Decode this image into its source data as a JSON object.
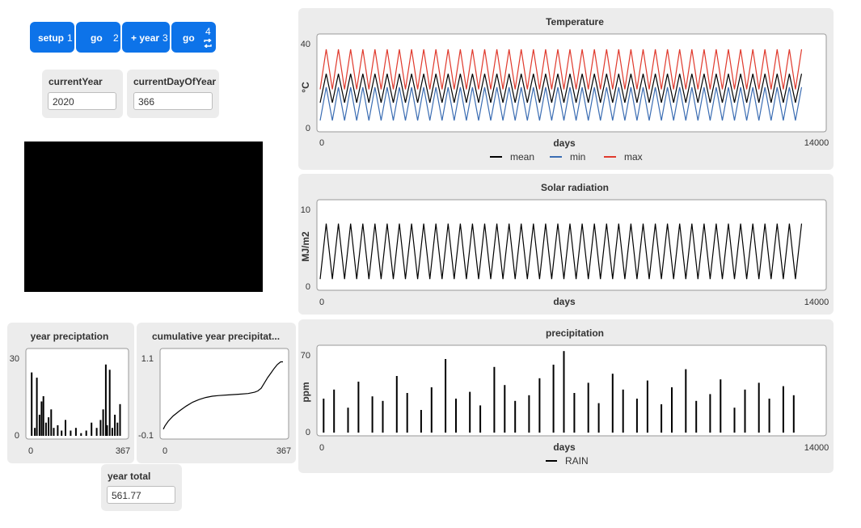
{
  "buttons": [
    {
      "label": "setup",
      "key": "1"
    },
    {
      "label": "go",
      "key": "2"
    },
    {
      "label": "+ year",
      "key": "3"
    },
    {
      "label": "go",
      "key": "4"
    }
  ],
  "monitors": {
    "current_year": {
      "label": "currentYear",
      "value": "2020"
    },
    "current_day": {
      "label": "currentDayOfYear",
      "value": "366"
    },
    "year_total": {
      "label": "year total",
      "value": "561.77"
    }
  },
  "colors": {
    "mean": "#000000",
    "min": "#3b6db3",
    "max": "#e03a2d",
    "rain": "#000000",
    "button": "#0d73e9"
  },
  "chart_data": [
    {
      "id": "temperature",
      "type": "line",
      "title": "Temperature",
      "xlabel": "days",
      "ylabel": "°C",
      "x_ticks": [
        "0",
        "14000"
      ],
      "y_ticks": [
        "40",
        "0"
      ],
      "xlim": [
        0,
        14000
      ],
      "ylim": [
        0,
        40
      ],
      "x": [
        0,
        175,
        350,
        525,
        700,
        875,
        1050,
        1225,
        1400,
        1575,
        1750,
        1925,
        2100,
        2275,
        2450,
        2625,
        2800,
        2975,
        3150,
        3325,
        3500,
        3675,
        3850,
        4025,
        4200,
        4375,
        4550,
        4725,
        4900,
        5075,
        5250,
        5425,
        5600,
        5775,
        5950,
        6125,
        6300,
        6475,
        6650,
        6825,
        7000,
        7175,
        7350,
        7525,
        7700,
        7875,
        8050,
        8225,
        8400,
        8575,
        8750,
        8925,
        9100,
        9275,
        9450,
        9625,
        9800,
        9975,
        10150,
        10325,
        10500,
        10675,
        10850,
        11025,
        11200,
        11375,
        11550,
        11725,
        11900,
        12075,
        12250,
        12425,
        12600,
        12775,
        12950,
        13125,
        13300,
        13475,
        13650,
        13825
      ],
      "series": [
        {
          "name": "mean",
          "values": [
            12,
            25,
            12,
            25,
            12,
            25,
            12,
            25,
            12,
            25,
            12,
            25,
            12,
            25,
            12,
            25,
            12,
            25,
            12,
            25,
            12,
            25,
            12,
            25,
            12,
            25,
            12,
            25,
            12,
            25,
            12,
            25,
            12,
            25,
            12,
            25,
            12,
            25,
            12,
            25,
            12,
            25,
            12,
            25,
            12,
            25,
            12,
            25,
            12,
            25,
            12,
            25,
            12,
            25,
            12,
            25,
            12,
            25,
            12,
            25,
            12,
            25,
            12,
            25,
            12,
            25,
            12,
            25,
            12,
            25,
            12,
            25,
            12,
            25,
            12,
            25,
            12,
            25,
            12,
            25
          ]
        },
        {
          "name": "min",
          "values": [
            4,
            19,
            4,
            19,
            4,
            19,
            4,
            19,
            4,
            19,
            4,
            19,
            4,
            19,
            4,
            19,
            4,
            19,
            4,
            19,
            4,
            19,
            4,
            19,
            4,
            19,
            4,
            19,
            4,
            19,
            4,
            19,
            4,
            19,
            4,
            19,
            4,
            19,
            4,
            19,
            4,
            19,
            4,
            19,
            4,
            19,
            4,
            19,
            4,
            19,
            4,
            19,
            4,
            19,
            4,
            19,
            4,
            19,
            4,
            19,
            4,
            19,
            4,
            19,
            4,
            19,
            4,
            19,
            4,
            19,
            4,
            19,
            4,
            19,
            4,
            19,
            4,
            19,
            4,
            19
          ]
        },
        {
          "name": "max",
          "values": [
            18,
            36,
            18,
            36,
            18,
            36,
            18,
            36,
            18,
            36,
            18,
            36,
            18,
            36,
            18,
            36,
            18,
            36,
            18,
            36,
            18,
            36,
            18,
            36,
            18,
            36,
            18,
            36,
            18,
            36,
            18,
            36,
            18,
            36,
            18,
            36,
            18,
            36,
            18,
            36,
            18,
            36,
            18,
            36,
            18,
            36,
            18,
            36,
            18,
            36,
            18,
            36,
            18,
            36,
            18,
            36,
            18,
            36,
            18,
            36,
            18,
            36,
            18,
            36,
            18,
            36,
            18,
            36,
            18,
            36,
            18,
            36,
            18,
            36,
            18,
            36,
            18,
            36,
            18,
            36
          ]
        }
      ],
      "legend": [
        "mean",
        "min",
        "max"
      ]
    },
    {
      "id": "solar",
      "type": "line",
      "title": "Solar radiation",
      "xlabel": "days",
      "ylabel": "MJ/m2",
      "x_ticks": [
        "0",
        "14000"
      ],
      "y_ticks": [
        "10",
        "0"
      ],
      "xlim": [
        0,
        14000
      ],
      "ylim": [
        0,
        10
      ],
      "x": [
        0,
        175,
        350,
        525,
        700,
        875,
        1050,
        1225,
        1400,
        1575,
        1750,
        1925,
        2100,
        2275,
        2450,
        2625,
        2800,
        2975,
        3150,
        3325,
        3500,
        3675,
        3850,
        4025,
        4200,
        4375,
        4550,
        4725,
        4900,
        5075,
        5250,
        5425,
        5600,
        5775,
        5950,
        6125,
        6300,
        6475,
        6650,
        6825,
        7000,
        7175,
        7350,
        7525,
        7700,
        7875,
        8050,
        8225,
        8400,
        8575,
        8750,
        8925,
        9100,
        9275,
        9450,
        9625,
        9800,
        9975,
        10150,
        10325,
        10500,
        10675,
        10850,
        11025,
        11200,
        11375,
        11550,
        11725,
        11900,
        12075,
        12250,
        12425,
        12600,
        12775,
        12950,
        13125,
        13300,
        13475,
        13650,
        13825
      ],
      "series": [
        {
          "name": "solar",
          "values": [
            1,
            8,
            1,
            8,
            1,
            8,
            1,
            8,
            1,
            8,
            1,
            8,
            1,
            8,
            1,
            8,
            1,
            8,
            1,
            8,
            1,
            8,
            1,
            8,
            1,
            8,
            1,
            8,
            1,
            8,
            1,
            8,
            1,
            8,
            1,
            8,
            1,
            8,
            1,
            8,
            1,
            8,
            1,
            8,
            1,
            8,
            1,
            8,
            1,
            8,
            1,
            8,
            1,
            8,
            1,
            8,
            1,
            8,
            1,
            8,
            1,
            8,
            1,
            8,
            1,
            8,
            1,
            8,
            1,
            8,
            1,
            8,
            1,
            8,
            1,
            8,
            1,
            8,
            1,
            8
          ]
        }
      ]
    },
    {
      "id": "precipitation",
      "type": "bar",
      "title": "precipitation",
      "xlabel": "days",
      "ylabel": "ppm",
      "x_ticks": [
        "0",
        "14000"
      ],
      "y_ticks": [
        "70",
        "0"
      ],
      "xlim": [
        0,
        14000
      ],
      "ylim": [
        0,
        70
      ],
      "x": [
        100,
        400,
        800,
        1100,
        1500,
        1800,
        2200,
        2500,
        2900,
        3200,
        3600,
        3900,
        4300,
        4600,
        5000,
        5300,
        5600,
        6000,
        6300,
        6700,
        7000,
        7300,
        7700,
        8000,
        8400,
        8700,
        9100,
        9400,
        9800,
        10100,
        10500,
        10800,
        11200,
        11500,
        11900,
        12200,
        12600,
        12900,
        13300,
        13600
      ],
      "series": [
        {
          "name": "RAIN",
          "values": [
            30,
            38,
            22,
            45,
            32,
            28,
            50,
            35,
            20,
            40,
            65,
            30,
            36,
            24,
            58,
            42,
            28,
            33,
            48,
            60,
            72,
            35,
            44,
            26,
            52,
            38,
            30,
            46,
            25,
            40,
            56,
            28,
            34,
            47,
            22,
            38,
            44,
            30,
            41,
            33
          ]
        }
      ],
      "legend": [
        "RAIN"
      ]
    },
    {
      "id": "year_precip",
      "type": "bar",
      "title": "year preciptation",
      "x_ticks": [
        "0",
        "367"
      ],
      "y_ticks": [
        "30",
        "0"
      ],
      "xlim": [
        0,
        367
      ],
      "ylim": [
        0,
        30
      ],
      "x": [
        10,
        22,
        30,
        40,
        48,
        55,
        65,
        75,
        85,
        95,
        110,
        125,
        140,
        160,
        180,
        200,
        220,
        240,
        260,
        275,
        285,
        295,
        300,
        310,
        320,
        330,
        340,
        350
      ],
      "series": [
        {
          "name": "rain",
          "values": [
            24,
            3,
            22,
            8,
            13,
            15,
            5,
            7,
            10,
            3,
            4,
            2,
            6,
            2,
            3,
            1,
            2,
            5,
            3,
            6,
            10,
            27,
            4,
            25,
            3,
            8,
            5,
            12
          ]
        }
      ]
    },
    {
      "id": "cumulative",
      "type": "line",
      "title": "cumulative year precipitat...",
      "x_ticks": [
        "0",
        "367"
      ],
      "y_ticks": [
        "1.1",
        "-0.1"
      ],
      "xlim": [
        0,
        367
      ],
      "ylim": [
        -0.1,
        1.1
      ],
      "x": [
        0,
        5,
        15,
        30,
        50,
        70,
        90,
        110,
        130,
        150,
        170,
        200,
        230,
        260,
        280,
        290,
        300,
        310,
        320,
        330,
        340,
        350,
        360,
        367
      ],
      "series": [
        {
          "name": "cumulative",
          "values": [
            0.0,
            0.05,
            0.12,
            0.2,
            0.28,
            0.35,
            0.41,
            0.45,
            0.48,
            0.5,
            0.51,
            0.52,
            0.53,
            0.54,
            0.56,
            0.58,
            0.62,
            0.7,
            0.78,
            0.85,
            0.92,
            0.98,
            1.02,
            1.02
          ]
        }
      ]
    }
  ]
}
